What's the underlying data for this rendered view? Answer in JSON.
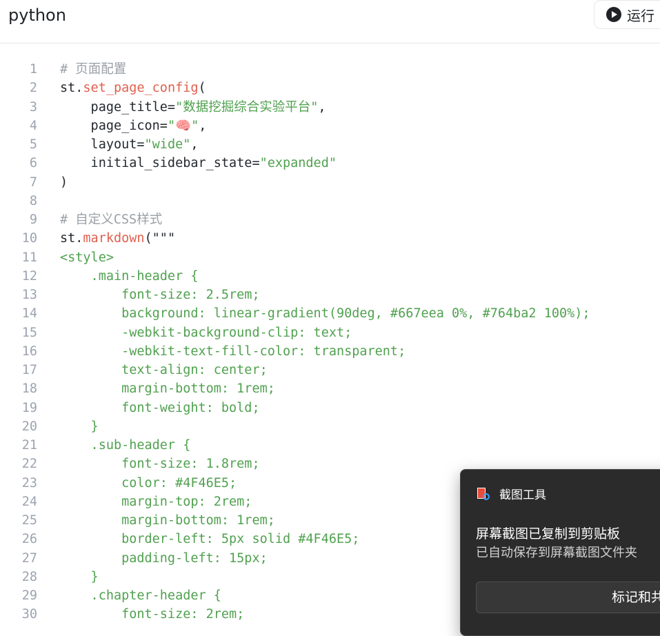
{
  "header": {
    "language": "python",
    "run_label": "运行"
  },
  "code_lines": [
    {
      "n": "1",
      "segments": [
        {
          "t": "# 页面配置",
          "c": "comment"
        }
      ]
    },
    {
      "n": "2",
      "segments": [
        {
          "t": "st.",
          "c": "plain"
        },
        {
          "t": "set_page_config",
          "c": "func"
        },
        {
          "t": "(",
          "c": "plain"
        }
      ]
    },
    {
      "n": "3",
      "segments": [
        {
          "t": "    page_title=",
          "c": "plain"
        },
        {
          "t": "\"数据挖掘综合实验平台\"",
          "c": "str"
        },
        {
          "t": ",",
          "c": "plain"
        }
      ]
    },
    {
      "n": "4",
      "segments": [
        {
          "t": "    page_icon=",
          "c": "plain"
        },
        {
          "t": "\"🧠\"",
          "c": "str"
        },
        {
          "t": ",",
          "c": "plain"
        }
      ]
    },
    {
      "n": "5",
      "segments": [
        {
          "t": "    layout=",
          "c": "plain"
        },
        {
          "t": "\"wide\"",
          "c": "str"
        },
        {
          "t": ",",
          "c": "plain"
        }
      ]
    },
    {
      "n": "6",
      "segments": [
        {
          "t": "    initial_sidebar_state=",
          "c": "plain"
        },
        {
          "t": "\"expanded\"",
          "c": "str"
        }
      ]
    },
    {
      "n": "7",
      "segments": [
        {
          "t": ")",
          "c": "plain"
        }
      ]
    },
    {
      "n": "8",
      "segments": []
    },
    {
      "n": "9",
      "segments": [
        {
          "t": "# 自定义CSS样式",
          "c": "comment"
        }
      ]
    },
    {
      "n": "10",
      "segments": [
        {
          "t": "st.",
          "c": "plain"
        },
        {
          "t": "markdown",
          "c": "func"
        },
        {
          "t": "(\"\"\"",
          "c": "plain"
        }
      ]
    },
    {
      "n": "11",
      "segments": [
        {
          "t": "<style>",
          "c": "str"
        }
      ]
    },
    {
      "n": "12",
      "segments": [
        {
          "t": "    .main-header {",
          "c": "str"
        }
      ]
    },
    {
      "n": "13",
      "segments": [
        {
          "t": "        font-size: 2.5rem;",
          "c": "str"
        }
      ]
    },
    {
      "n": "14",
      "segments": [
        {
          "t": "        background: linear-gradient(90deg, #667eea 0%, #764ba2 100%);",
          "c": "str"
        }
      ]
    },
    {
      "n": "15",
      "segments": [
        {
          "t": "        -webkit-background-clip: text;",
          "c": "str"
        }
      ]
    },
    {
      "n": "16",
      "segments": [
        {
          "t": "        -webkit-text-fill-color: transparent;",
          "c": "str"
        }
      ]
    },
    {
      "n": "17",
      "segments": [
        {
          "t": "        text-align: center;",
          "c": "str"
        }
      ]
    },
    {
      "n": "18",
      "segments": [
        {
          "t": "        margin-bottom: 1rem;",
          "c": "str"
        }
      ]
    },
    {
      "n": "19",
      "segments": [
        {
          "t": "        font-weight: bold;",
          "c": "str"
        }
      ]
    },
    {
      "n": "20",
      "segments": [
        {
          "t": "    }",
          "c": "str"
        }
      ]
    },
    {
      "n": "21",
      "segments": [
        {
          "t": "    .sub-header {",
          "c": "str"
        }
      ]
    },
    {
      "n": "22",
      "segments": [
        {
          "t": "        font-size: 1.8rem;",
          "c": "str"
        }
      ]
    },
    {
      "n": "23",
      "segments": [
        {
          "t": "        color: #4F46E5;",
          "c": "str"
        }
      ]
    },
    {
      "n": "24",
      "segments": [
        {
          "t": "        margin-top: 2rem;",
          "c": "str"
        }
      ]
    },
    {
      "n": "25",
      "segments": [
        {
          "t": "        margin-bottom: 1rem;",
          "c": "str"
        }
      ]
    },
    {
      "n": "26",
      "segments": [
        {
          "t": "        border-left: 5px solid #4F46E5;",
          "c": "str"
        }
      ]
    },
    {
      "n": "27",
      "segments": [
        {
          "t": "        padding-left: 15px;",
          "c": "str"
        }
      ]
    },
    {
      "n": "28",
      "segments": [
        {
          "t": "    }",
          "c": "str"
        }
      ]
    },
    {
      "n": "29",
      "segments": [
        {
          "t": "    .chapter-header {",
          "c": "str"
        }
      ]
    },
    {
      "n": "30",
      "segments": [
        {
          "t": "        font-size: 2rem;",
          "c": "str"
        }
      ]
    }
  ],
  "toast": {
    "app_name": "截图工具",
    "title": "屏幕截图已复制到剪贴板",
    "body": "已自动保存到屏幕截图文件夹",
    "action_label": "标记和共享"
  },
  "colors": {
    "comment": "#9aa0a6",
    "func": "#e0604f",
    "string": "#50a14f",
    "plain": "#24292f",
    "line_number": "#9ca3af",
    "toast_bg": "#2b2b2b"
  },
  "icons": {
    "run": "play-circle-icon",
    "toast_app": "snipping-tool-icon"
  }
}
